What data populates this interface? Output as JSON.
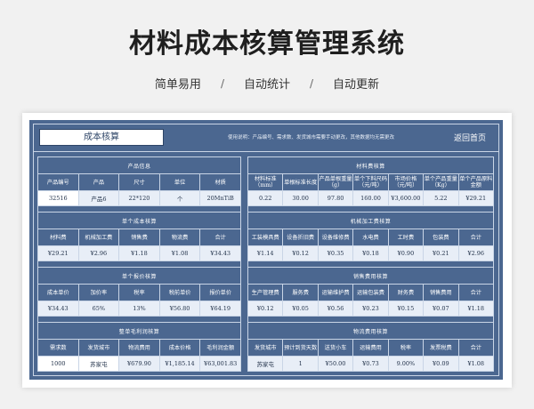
{
  "header": {
    "title": "材料成本核算管理系统",
    "subtitle": [
      "简单易用",
      "自动统计",
      "自动更新"
    ],
    "separator": "/"
  },
  "topbar": {
    "title": "成本核算",
    "hint": "使用说明：产品编号、需求数、发货城市需要手动更改，其他数据均无需更改",
    "back_label": "返回首页"
  },
  "left": {
    "product_info": {
      "section": "产品信息",
      "headers": [
        "产品编号",
        "产品",
        "尺寸",
        "单位",
        "材质"
      ],
      "values": [
        "32516",
        "产品6",
        "22*120",
        "个",
        "20MnTiB"
      ]
    },
    "unit_cost": {
      "section": "单个成本核算",
      "headers": [
        "材料费",
        "机械加工费",
        "销售费",
        "物流费",
        "合计"
      ],
      "values": [
        "¥29.21",
        "¥2.96",
        "¥1.18",
        "¥1.08",
        "¥34.43"
      ]
    },
    "unit_quote": {
      "section": "单个报价核算",
      "headers": [
        "成本单价",
        "加价率",
        "税率",
        "税前单价",
        "报价单价"
      ],
      "values": [
        "¥34.43",
        "65%",
        "13%",
        "¥56.80",
        "¥64.19"
      ]
    },
    "gross_profit": {
      "section": "整单毛利润核算",
      "headers": [
        "需求数",
        "发货城市",
        "物流费用",
        "成本价格",
        "毛利润金额"
      ],
      "values": [
        "1000",
        "苏家屯",
        "¥679.90",
        "¥1,185.14",
        "¥63,001.83"
      ]
    }
  },
  "right": {
    "material_cost": {
      "section": "材料费核算",
      "headers": [
        "材料标准（mm）",
        "单根标准长度",
        "产品单根重量（g）",
        "单个下料尺码（元/吨）",
        "市场价格（元/吨）",
        "单个产品重量（Kg）",
        "单个产品原料金额"
      ],
      "values": [
        "0.22",
        "30.00",
        "97.80",
        "160.00",
        "¥3,600.00",
        "5.22",
        "¥29.21"
      ]
    },
    "machining_cost": {
      "section": "机械加工费核算",
      "headers": [
        "工装模具费",
        "设备折旧费",
        "设备维修费",
        "水电费",
        "工时费",
        "包装费",
        "合计"
      ],
      "values": [
        "¥1.14",
        "¥0.12",
        "¥0.35",
        "¥0.18",
        "¥0.90",
        "¥0.21",
        "¥2.96"
      ]
    },
    "sales_cost": {
      "section": "销售费用核算",
      "headers": [
        "生产管理费",
        "服务费",
        "运输维护费",
        "运输包装费",
        "财务费",
        "销售费用",
        "合计"
      ],
      "values": [
        "¥0.12",
        "¥0.05",
        "¥0.56",
        "¥0.23",
        "¥0.15",
        "¥0.07",
        "¥1.18"
      ]
    },
    "logistics_cost": {
      "section": "物流费用核算",
      "headers": [
        "发货城市",
        "预计到货天数",
        "送货小车",
        "运输费用",
        "税率",
        "发票税费",
        "合计"
      ],
      "values": [
        "苏家屯",
        "1",
        "¥50.00",
        "¥0.73",
        "9.00%",
        "¥0.09",
        "¥1.08"
      ]
    }
  },
  "colors": {
    "board": "#4b6790",
    "grid_line": "#c9d5e6",
    "value_cell": "#e8eef7",
    "input_cell": "#ffffff"
  }
}
